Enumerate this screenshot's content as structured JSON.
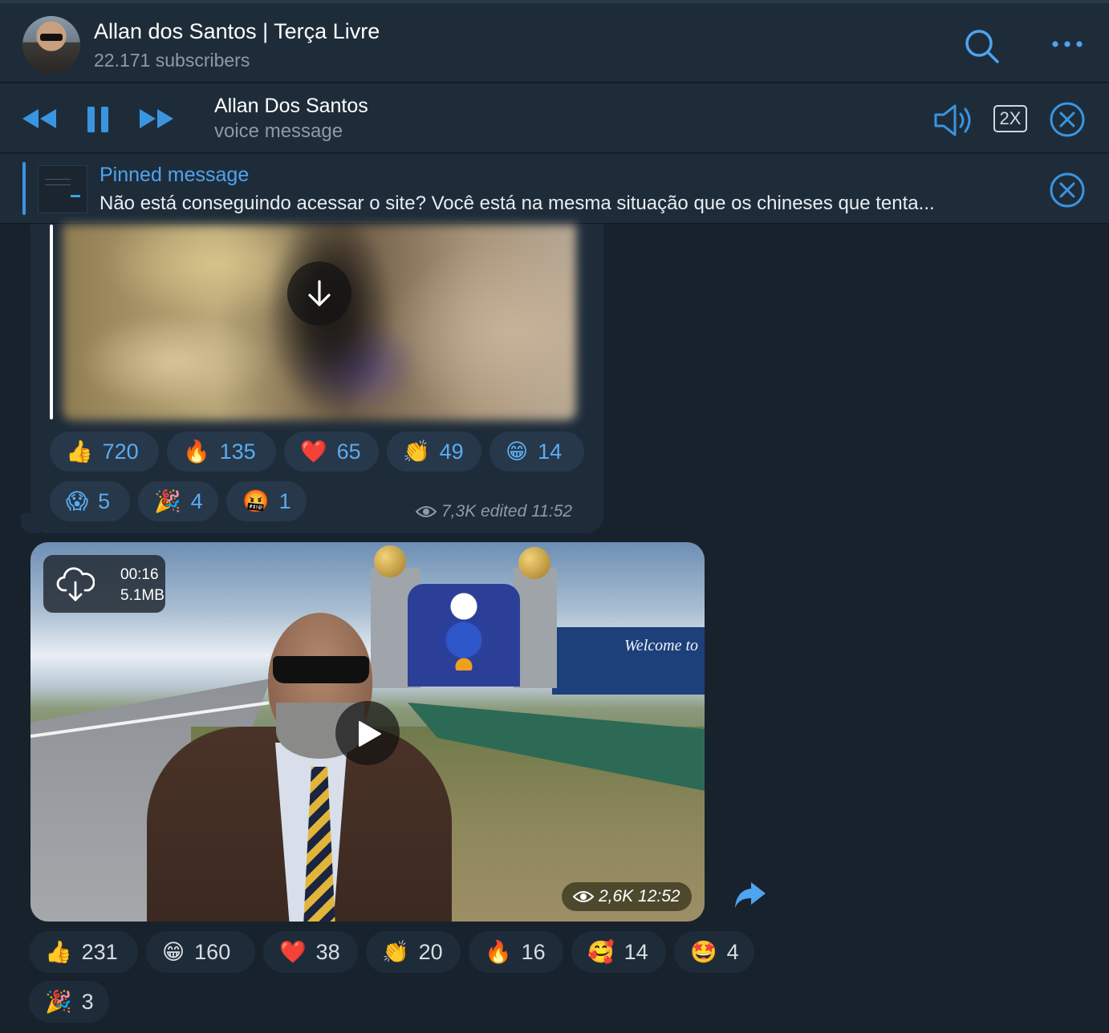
{
  "header": {
    "title": "Allan dos Santos | Terça Livre",
    "subtitle": "22.171 subscribers"
  },
  "player": {
    "title": "Allan Dos Santos",
    "subtitle": "voice message",
    "speed": "2X"
  },
  "pinned": {
    "title": "Pinned message",
    "text": "Não está conseguindo acessar o site? Você está na mesma situação que os chineses que tenta..."
  },
  "message1": {
    "reactions_row1": [
      {
        "emoji": "👍",
        "count": "720"
      },
      {
        "emoji": "🔥",
        "count": "135"
      },
      {
        "emoji": "❤️",
        "count": "65"
      },
      {
        "emoji": "👏",
        "count": "49"
      },
      {
        "emoji": "😁",
        "count": "14"
      }
    ],
    "reactions_row2": [
      {
        "emoji": "😱",
        "count": "5"
      },
      {
        "emoji": "🎉",
        "count": "4"
      },
      {
        "emoji": "🤬",
        "count": "1"
      }
    ],
    "meta": "7,3K edited 11:52"
  },
  "message2": {
    "video": {
      "duration": "00:16",
      "size": "5.1MB",
      "sign_text": "Welcome to",
      "meta": "2,6K 12:52"
    },
    "reactions_row1": [
      {
        "emoji": "👍",
        "count": "231"
      },
      {
        "emoji": "😁",
        "count": "160"
      },
      {
        "emoji": "❤️",
        "count": "38"
      },
      {
        "emoji": "👏",
        "count": "20"
      },
      {
        "emoji": "🔥",
        "count": "16"
      },
      {
        "emoji": "🥰",
        "count": "14"
      },
      {
        "emoji": "🤩",
        "count": "4"
      }
    ],
    "reactions_row2": [
      {
        "emoji": "🎉",
        "count": "3"
      }
    ]
  },
  "colors": {
    "background": "#18222d",
    "panel": "#1e2c3a",
    "accent": "#3a95e0",
    "reaction_bg": "#27384a",
    "muted": "#8d9aa7"
  }
}
